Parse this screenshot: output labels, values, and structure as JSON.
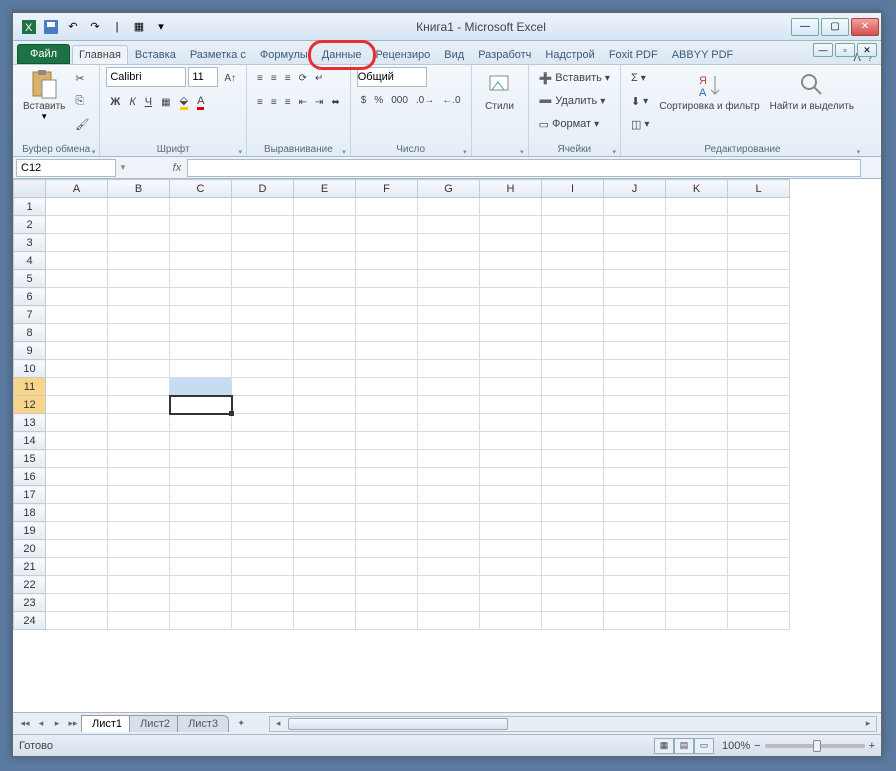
{
  "title": "Книга1 - Microsoft Excel",
  "tabs": {
    "file": "Файл",
    "home": "Главная",
    "insert": "Вставка",
    "layout": "Разметка с",
    "formulas": "Формулы",
    "data": "Данные",
    "review": "Рецензиро",
    "view": "Вид",
    "developer": "Разработч",
    "addins": "Надстрой",
    "foxit": "Foxit PDF",
    "abbyy": "ABBYY PDF"
  },
  "groups": {
    "clipboard": {
      "label": "Буфер обмена",
      "paste": "Вставить"
    },
    "font": {
      "label": "Шрифт",
      "name": "Calibri",
      "size": "11"
    },
    "align": {
      "label": "Выравнивание"
    },
    "number": {
      "label": "Число",
      "format": "Общий"
    },
    "styles": {
      "label": "",
      "styles": "Стили"
    },
    "cells": {
      "label": "Ячейки",
      "insert": "Вставить",
      "delete": "Удалить",
      "format": "Формат"
    },
    "editing": {
      "label": "Редактирование",
      "sort": "Сортировка и фильтр",
      "find": "Найти и выделить"
    }
  },
  "namebox": "C12",
  "fx": "fx",
  "columns": [
    "A",
    "B",
    "C",
    "D",
    "E",
    "F",
    "G",
    "H",
    "I",
    "J",
    "K",
    "L"
  ],
  "rows": [
    "1",
    "2",
    "3",
    "4",
    "5",
    "6",
    "7",
    "8",
    "9",
    "10",
    "11",
    "12",
    "13",
    "14",
    "15",
    "16",
    "17",
    "18",
    "19",
    "20",
    "21",
    "22",
    "23",
    "24"
  ],
  "sheets": {
    "s1": "Лист1",
    "s2": "Лист2",
    "s3": "Лист3"
  },
  "status": "Готово",
  "zoom": "100%"
}
